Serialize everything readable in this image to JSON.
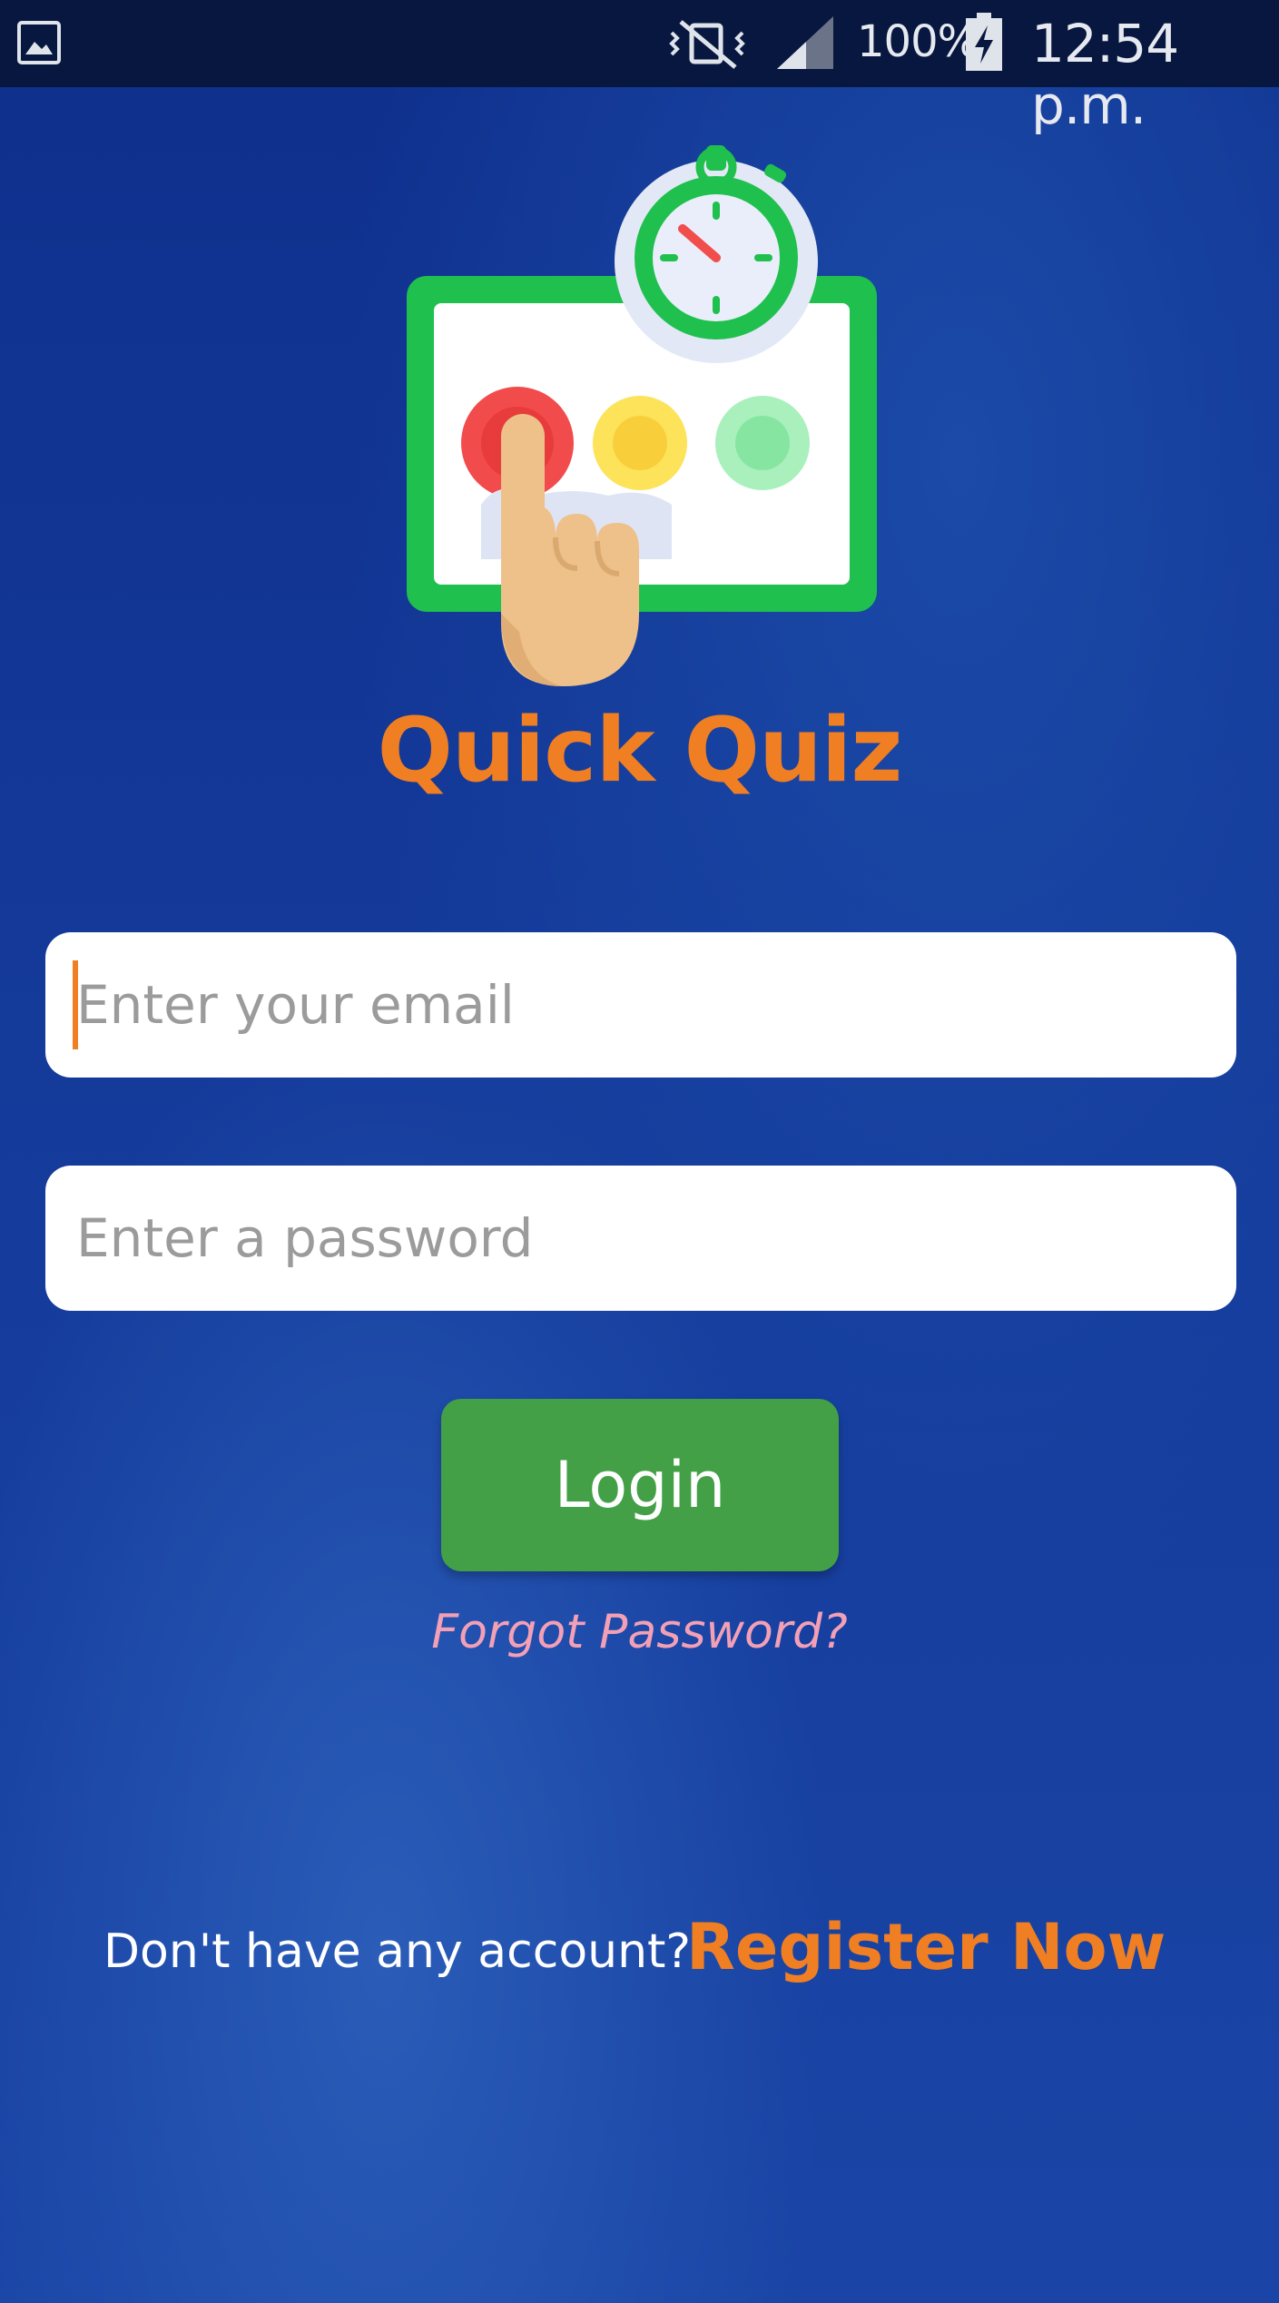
{
  "status_bar": {
    "battery_percent": "100%",
    "time": "12:54 p.m.",
    "icons": [
      "gallery-icon",
      "vibrate-mute-icon",
      "signal-icon",
      "battery-charging-icon"
    ]
  },
  "app": {
    "title": "Quick Quiz",
    "logo_icon": "quiz-buzzer-stopwatch-icon"
  },
  "form": {
    "email_placeholder": "Enter your email",
    "email_value": "",
    "password_placeholder": "Enter a password",
    "password_value": "",
    "login_label": "Login",
    "forgot_label": "Forgot Password?"
  },
  "footer": {
    "no_account_text": "Don't have any account?",
    "register_label": "Register Now"
  },
  "colors": {
    "accent": "#f07e22",
    "login_button": "#43a047",
    "forgot_link": "#f3a0b6",
    "status_bar": "#07173f",
    "background": "#143a9a"
  }
}
